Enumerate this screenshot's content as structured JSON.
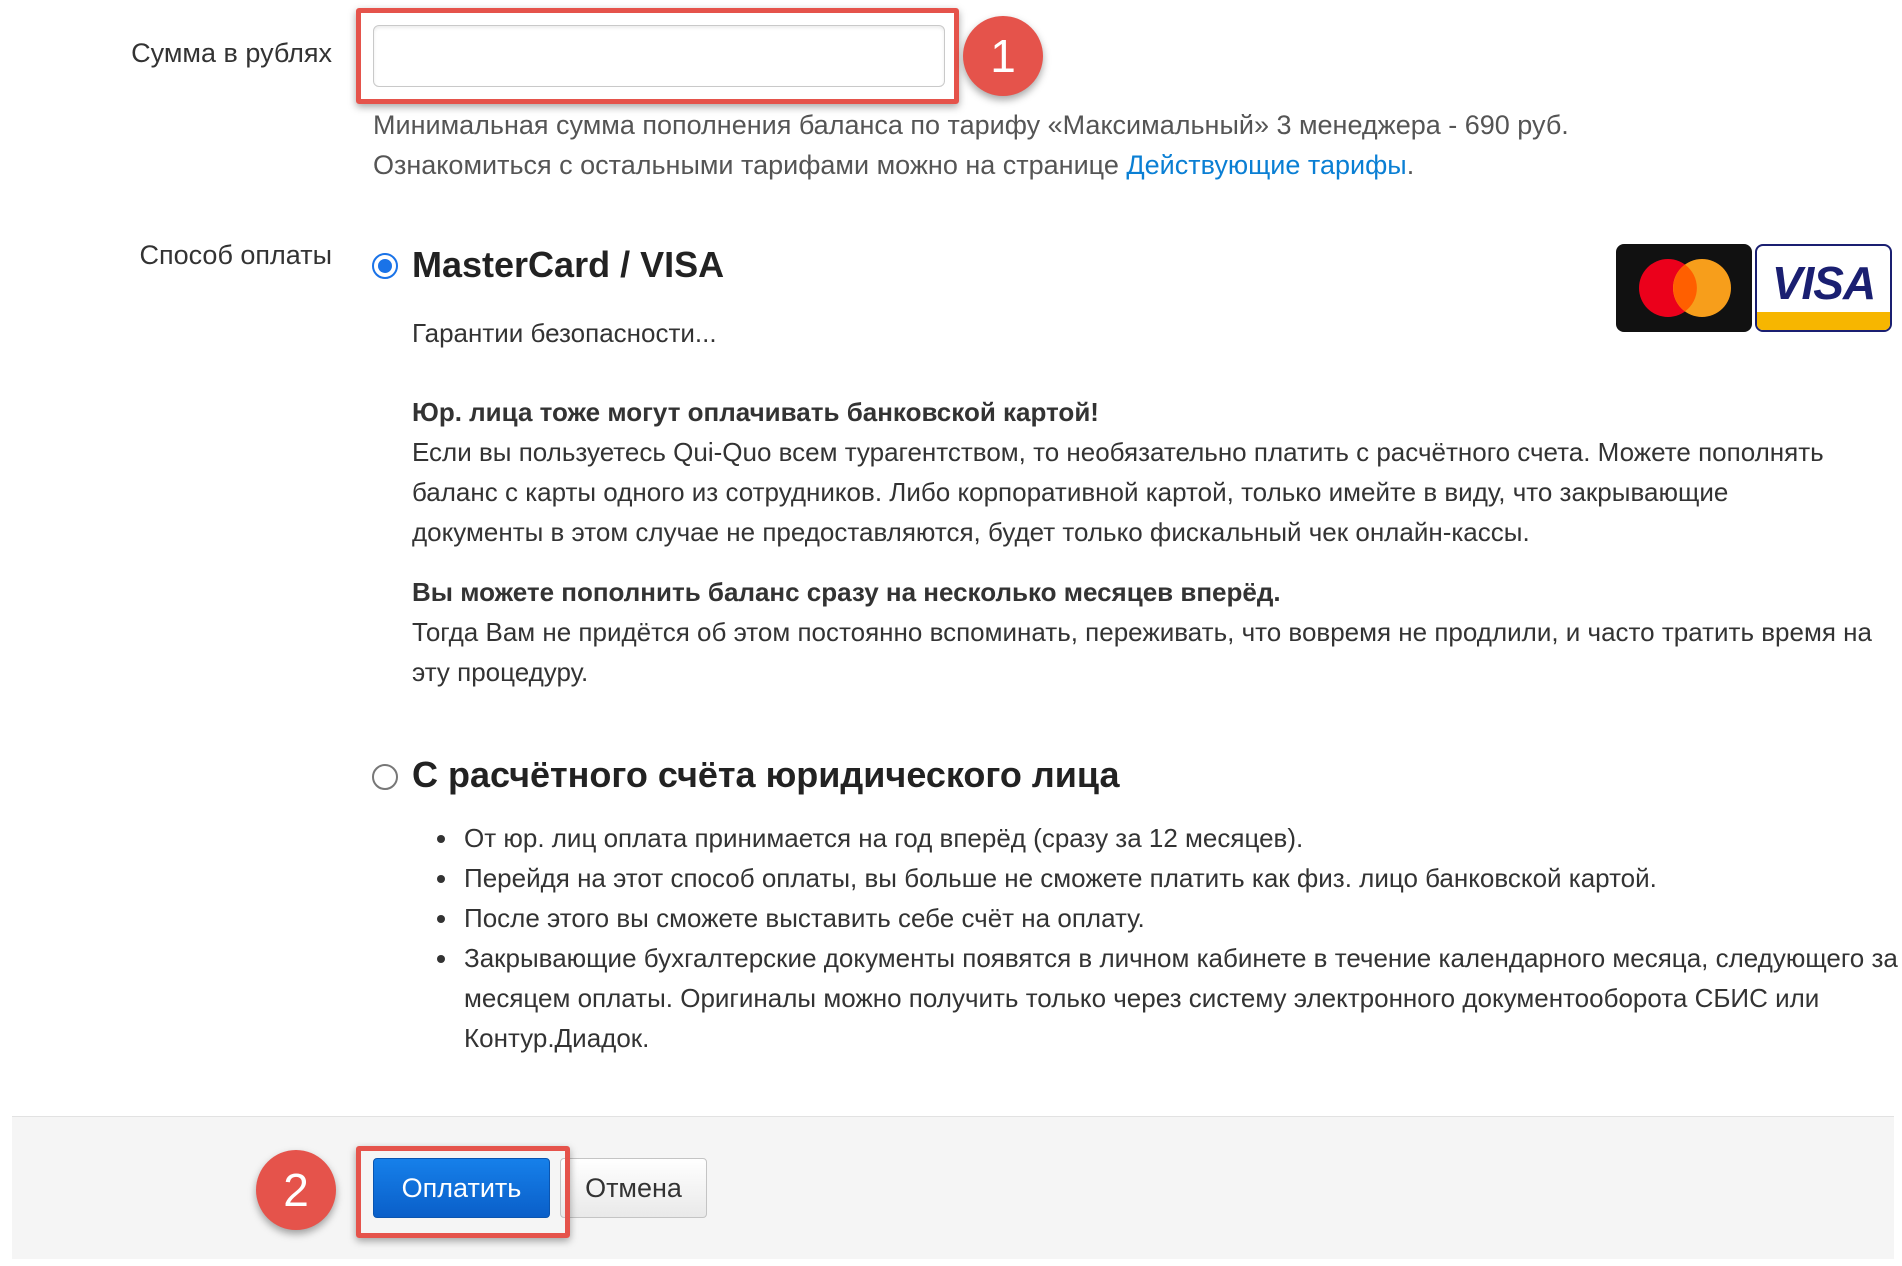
{
  "amount": {
    "label": "Сумма в рублях",
    "value": "",
    "hint_line1": "Минимальная сумма пополнения баланса по тарифу «Максимальный» 3 менеджера - 690 руб.",
    "hint_line2_prefix": "Ознакомиться с остальными тарифами можно на странице ",
    "hint_link": "Действующие тарифы",
    "hint_line2_suffix": "."
  },
  "payment": {
    "label": "Способ оплаты",
    "card_option": {
      "title": "MasterCard / VISA",
      "selected": true,
      "security_link": "Гарантии безопасности...",
      "para1_bold": "Юр. лица тоже могут оплачивать банковской картой!",
      "para1_text": "Если вы пользуетесь Qui-Quo всем турагентством, то необязательно платить с расчётного счета. Можете пополнять баланс с карты одного из сотрудников. Либо корпоративной картой, только имейте в виду, что закрывающие документы в этом случае не предоставляются, будет только фискальный чек онлайн-кассы.",
      "para2_bold": "Вы можете пополнить баланс сразу на несколько месяцев вперёд.",
      "para2_text": "Тогда Вам не придётся об этом постоянно вспоминать, переживать, что вовремя не продлили, и часто тратить время на эту процедуру.",
      "logos": {
        "mastercard": "mastercard-logo",
        "visa": "VISA"
      }
    },
    "bank_option": {
      "title": "С расчётного счёта юридического лица",
      "selected": false,
      "bullets": [
        "От юр. лиц оплата принимается на год вперёд (сразу за 12 месяцев).",
        "Перейдя на этот способ оплаты, вы больше не сможете платить как физ. лицо банковской картой.",
        "После этого вы сможете выставить себе счёт на оплату.",
        "Закрывающие бухгалтерские документы появятся в личном кабинете в течение календарного месяца, следующего за месяцем оплаты. Оригиналы можно получить только через систему электронного документооборота СБИС или Контур.Диадок."
      ]
    }
  },
  "footer": {
    "pay_button": "Оплатить",
    "cancel_button": "Отмена"
  },
  "annotations": {
    "badge1": "1",
    "badge2": "2",
    "callout_color": "#e5534b"
  },
  "colors": {
    "link": "#0a7fd4",
    "primary_button": "#0a6ad6",
    "radio_selected": "#1a73e8"
  }
}
